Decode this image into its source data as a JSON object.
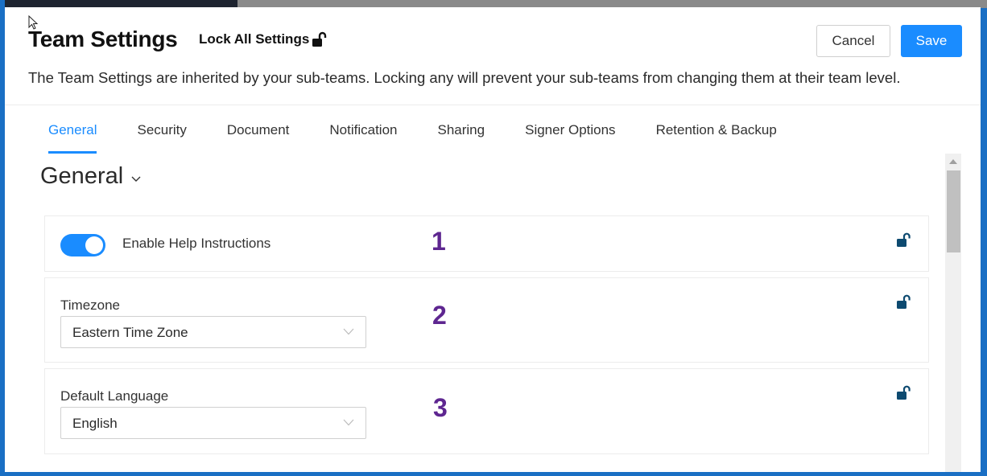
{
  "dialog": {
    "title": "Team Settings",
    "lock_all_label": "Lock All Settings",
    "subtitle": "The Team Settings are inherited by your sub-teams. Locking any will prevent your sub-teams from changing them at their team level.",
    "cancel_label": "Cancel",
    "save_label": "Save"
  },
  "tabs": [
    {
      "label": "General",
      "active": true
    },
    {
      "label": "Security",
      "active": false
    },
    {
      "label": "Document",
      "active": false
    },
    {
      "label": "Notification",
      "active": false
    },
    {
      "label": "Sharing",
      "active": false
    },
    {
      "label": "Signer Options",
      "active": false
    },
    {
      "label": "Retention & Backup",
      "active": false
    }
  ],
  "section": {
    "title": "General"
  },
  "settings": {
    "help_instructions": {
      "label": "Enable Help Instructions",
      "enabled": true,
      "annotation": "1",
      "locked": false
    },
    "timezone": {
      "label": "Timezone",
      "value": "Eastern Time Zone",
      "annotation": "2",
      "locked": false
    },
    "language": {
      "label": "Default Language",
      "value": "English",
      "annotation": "3",
      "locked": false
    }
  },
  "colors": {
    "accent": "#1a8cff",
    "lock_icon": "#0d4a70",
    "annotation": "#5e2690",
    "frame": "#1a6fc4"
  }
}
